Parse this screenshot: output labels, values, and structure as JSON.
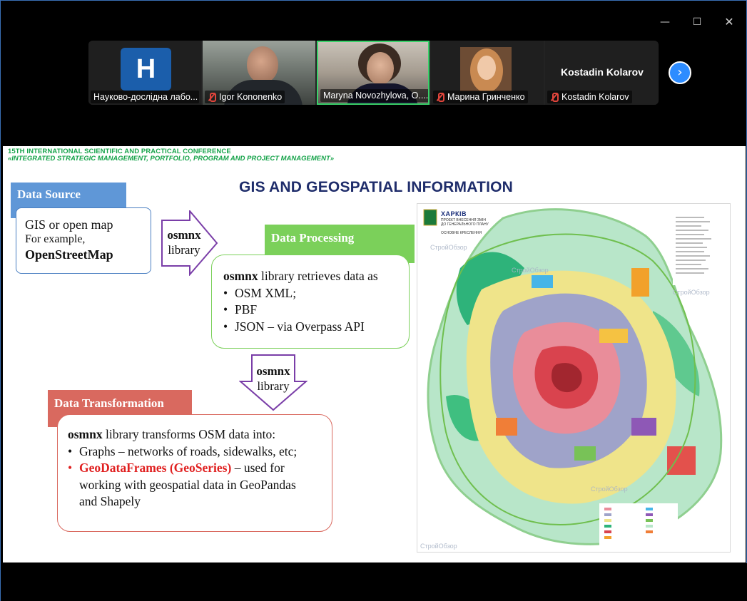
{
  "window": {
    "controls": {
      "minimize": "—",
      "maximize": "☐",
      "close": "✕"
    }
  },
  "participants": [
    {
      "name": "Науково-дослідна лабо...",
      "logo_letter": "H",
      "muted": false
    },
    {
      "name": "Igor Kononenko",
      "muted": true
    },
    {
      "name": "Maryna Novozhylova, O....",
      "muted": false,
      "active_speaker": true
    },
    {
      "name": "Марина Гринченко",
      "muted": true
    },
    {
      "name": "Kostadin Kolarov",
      "display_name": "Kostadin Kolarov",
      "muted": true
    }
  ],
  "strip_next_icon": "›",
  "colors": {
    "accent_blue": "#2d8cff",
    "speaker_border": "#3ad16a",
    "conference_green": "#16a34a",
    "title_navy": "#1f2d6b",
    "data_source": "#5f97d7",
    "data_processing": "#7bd05a",
    "data_transformation": "#d9695f",
    "highlight_red": "#e02020"
  },
  "slide": {
    "conference_line1": "15TH INTERNATIONAL SCIENTIFIC AND PRACTICAL CONFERENCE",
    "conference_line2": "«INTEGRATED STRATEGIC MANAGEMENT, PORTFOLIO, PROGRAM AND PROJECT MANAGEMENT»",
    "title": "GIS AND GEOSPATIAL INFORMATION",
    "data_source": {
      "header": "Data Source",
      "line1": "GIS or open map",
      "line2": "For example,",
      "line3": "OpenStreetMap"
    },
    "arrow_right": {
      "line1": "osmnx",
      "line2": "library"
    },
    "data_processing": {
      "header": "Data Processing",
      "lead_bold": "osmnx",
      "lead_rest": " library retrieves data as",
      "bullets": [
        "OSM XML;",
        "PBF",
        "JSON – via Overpass API"
      ]
    },
    "arrow_down": {
      "line1": "osmnx",
      "line2": "library"
    },
    "data_transformation": {
      "header": "Data Transformation",
      "lead_bold": "osmnx",
      "lead_rest": " library transforms OSM data into:",
      "bullet1": "Graphs – networks of roads, sidewalks, etc;",
      "bullet2_red": "GeoDataFrames (GeoSeries)",
      "bullet2_rest": " – used for",
      "bullet2_line2": "working with geospatial data in GeoPandas",
      "bullet2_line3": "and Shapely"
    },
    "map": {
      "title": "ХАРКІВ",
      "sub1": "ПРОЕКТ ВНЕСЕННЯ ЗМІН",
      "sub2": "ДО ГЕНЕРАЛЬНОГО ПЛАНУ",
      "sub3": "ОСНОВНЕ КРЕСЛЕННЯ",
      "watermark": "СтройОбзор"
    }
  }
}
